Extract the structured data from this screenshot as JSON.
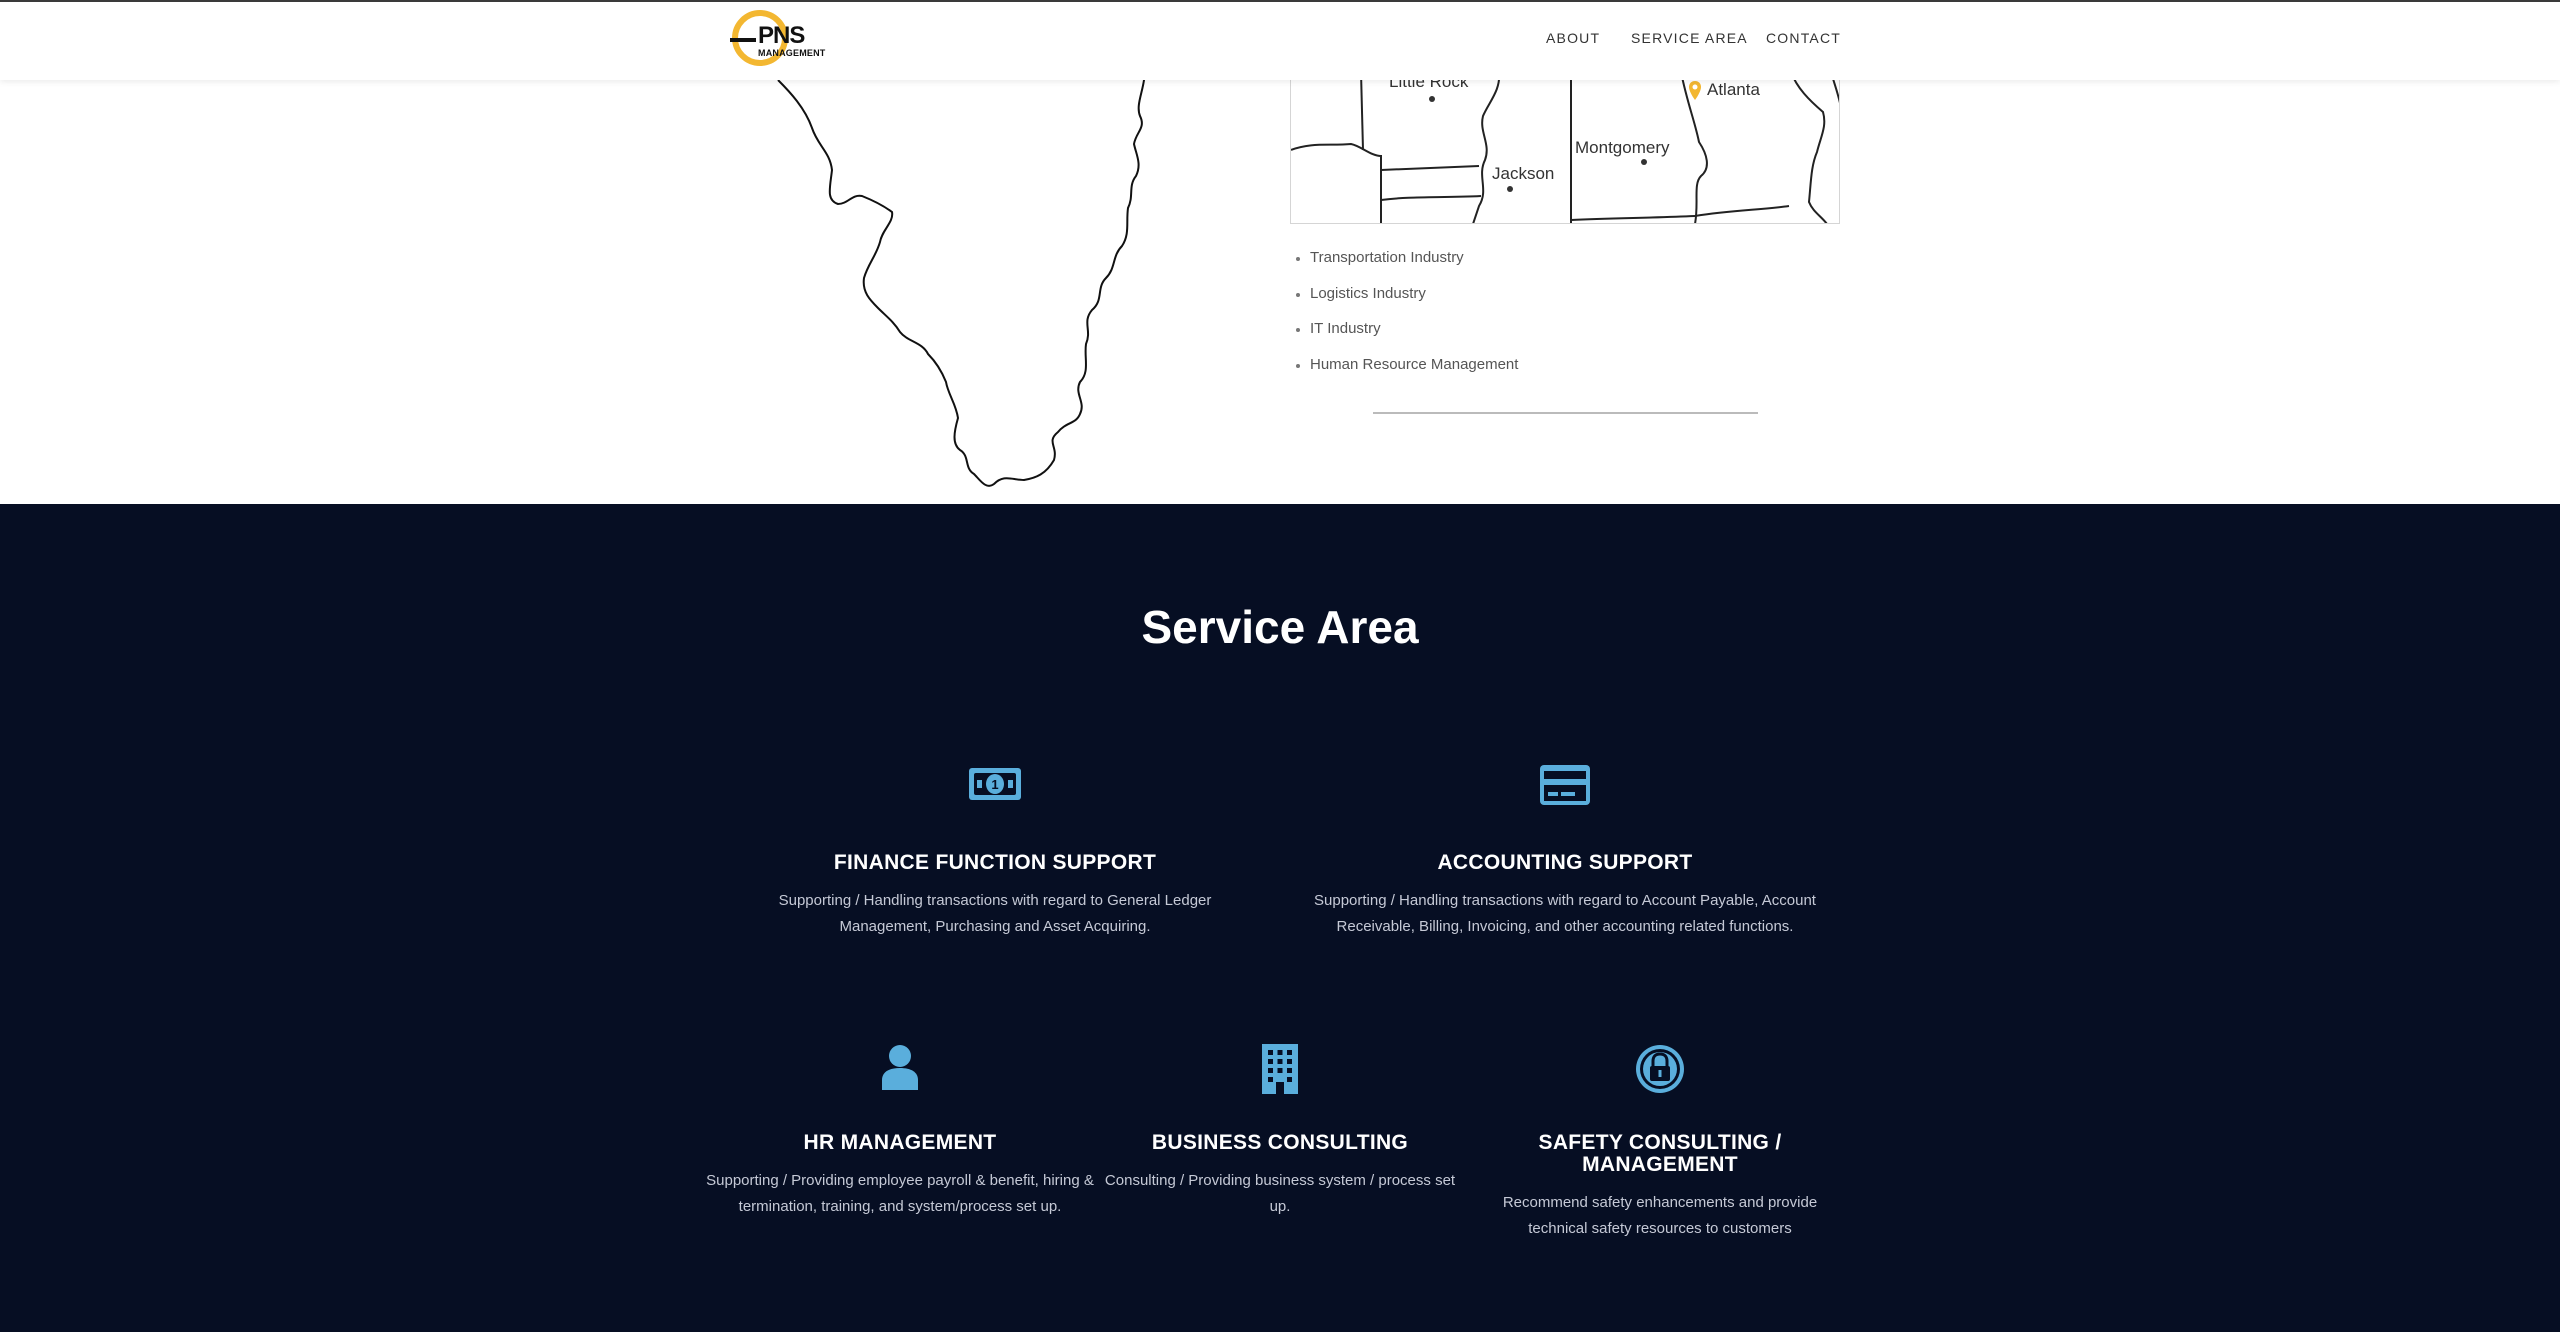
{
  "header": {
    "logo_main": "PNS",
    "logo_sub": "MANAGEMENT",
    "nav": {
      "about": "ABOUT",
      "service_area": "SERVICE AREA",
      "contact": "CONTACT"
    }
  },
  "map": {
    "cities": {
      "little_rock": "Little Rock",
      "atlanta": "Atlanta",
      "jackson": "Jackson",
      "montgomery": "Montgomery"
    },
    "marker_icon": "map-pin-icon",
    "marker_color": "#f3b731"
  },
  "industries": [
    "Transportation Industry",
    "Logistics Industry",
    "IT Industry",
    "Human Resource Management"
  ],
  "service_area": {
    "title": "Service Area",
    "accent_color": "#5aaedc",
    "background_color": "#060e23",
    "items": [
      {
        "icon": "money-bill-icon",
        "title": "FINANCE FUNCTION SUPPORT",
        "description": "Supporting / Handling transactions with regard to General Ledger Management, Purchasing and Asset Acquiring."
      },
      {
        "icon": "credit-card-icon",
        "title": "ACCOUNTING SUPPORT",
        "description": "Supporting / Handling transactions with regard to Account Payable, Account Receivable, Billing, Invoicing, and other accounting related functions."
      },
      {
        "icon": "user-icon",
        "title": "HR MANAGEMENT",
        "description": "Supporting / Providing employee payroll & benefit, hiring & termination, training, and system/process set up."
      },
      {
        "icon": "building-icon",
        "title": "BUSINESS CONSULTING",
        "description": "Consulting / Providing business system / process set up."
      },
      {
        "icon": "lock-icon",
        "title": "SAFETY CONSULTING / MANAGEMENT",
        "description": "Recommend safety enhancements and provide technical safety resources to customers"
      }
    ]
  }
}
